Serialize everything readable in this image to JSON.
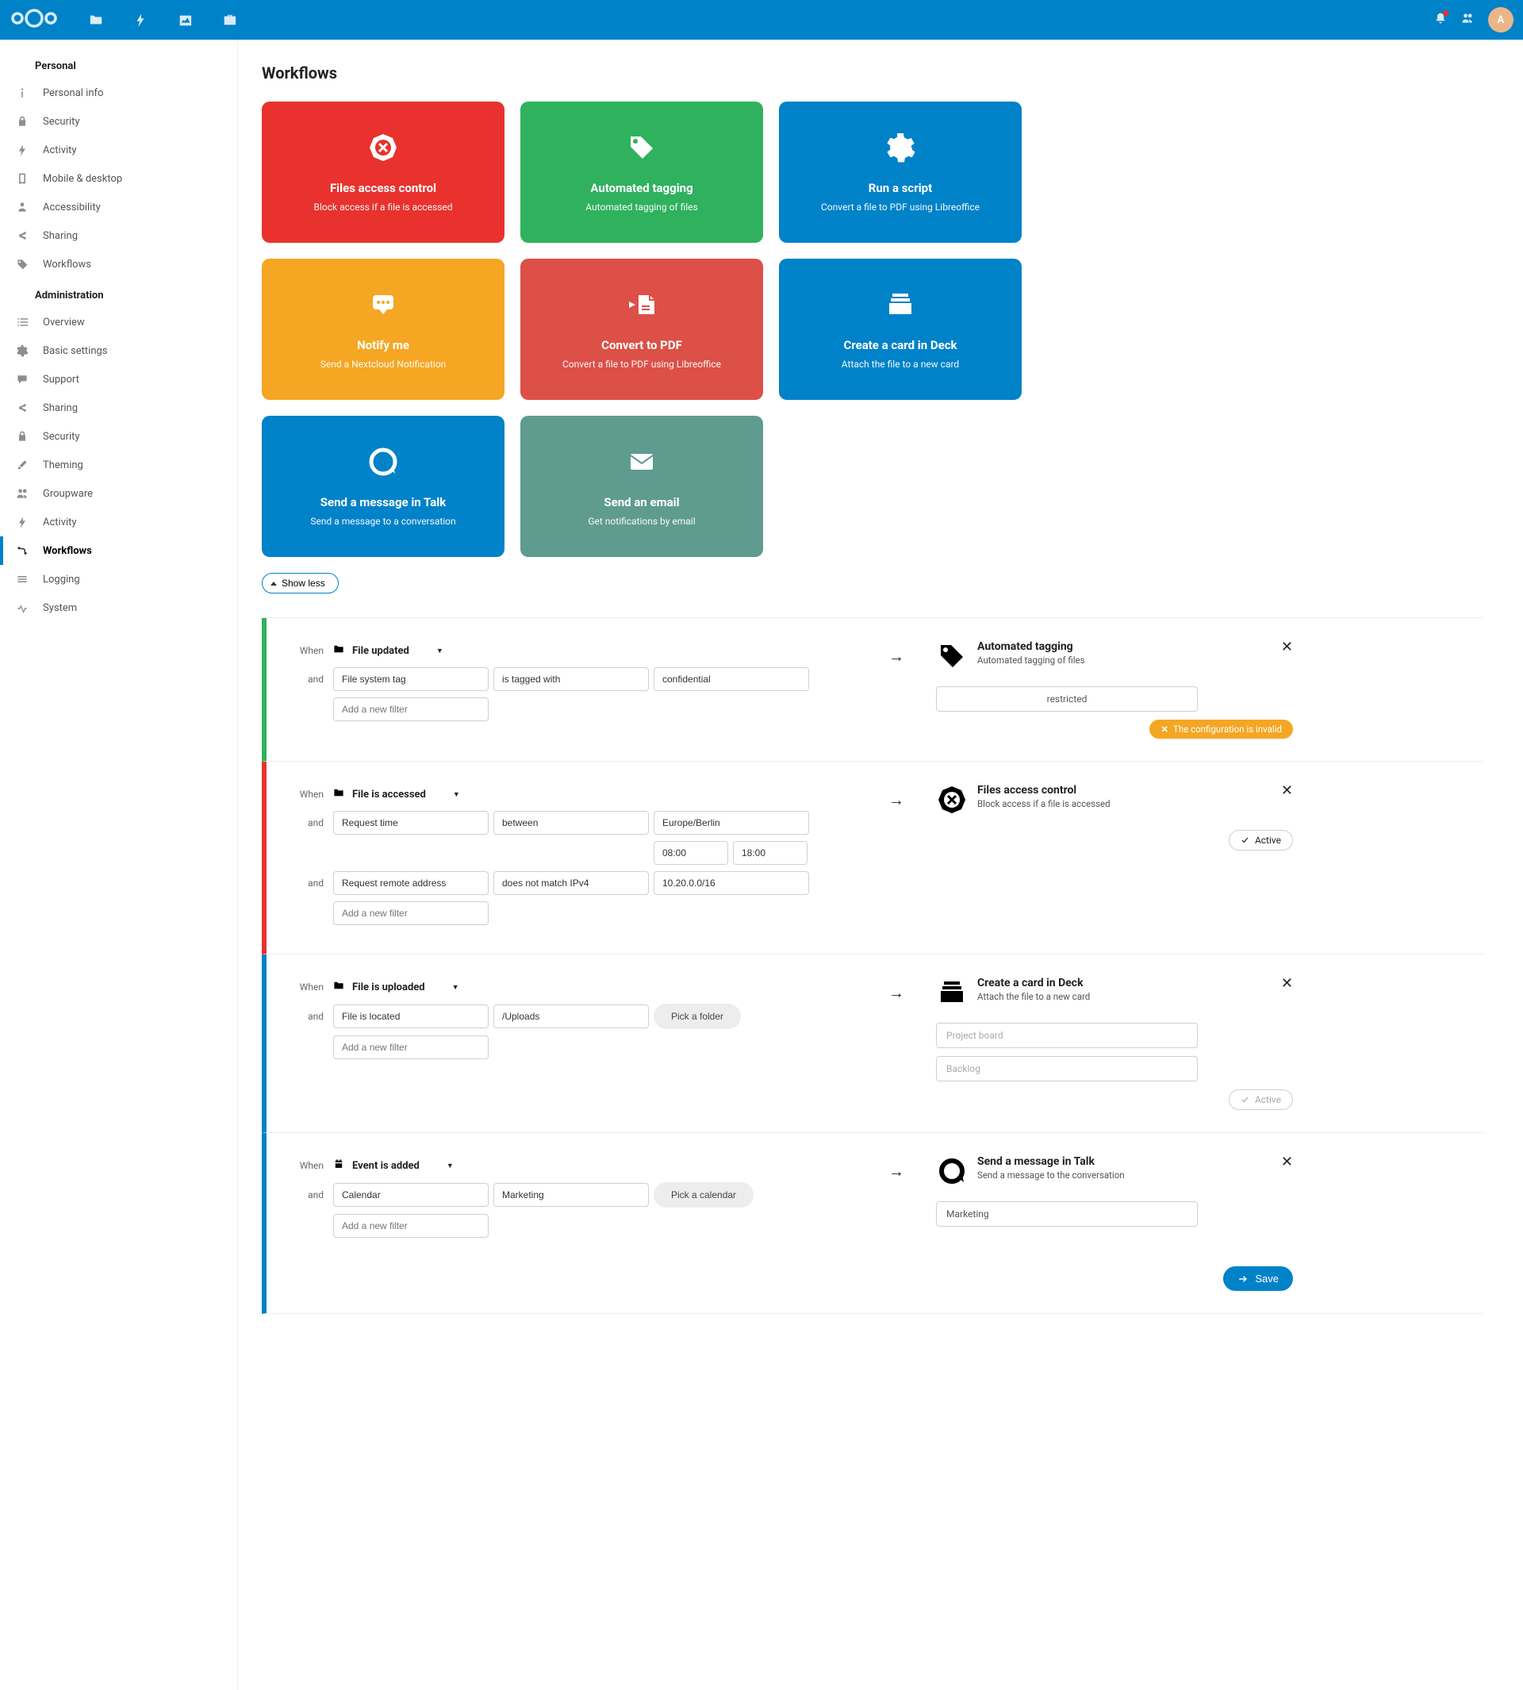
{
  "topbar": {
    "avatar_initial": "A"
  },
  "sidebar": {
    "personal_header": "Personal",
    "personal": [
      {
        "label": "Personal info",
        "key": "personal-info"
      },
      {
        "label": "Security",
        "key": "security"
      },
      {
        "label": "Activity",
        "key": "activity"
      },
      {
        "label": "Mobile & desktop",
        "key": "mobile-desktop"
      },
      {
        "label": "Accessibility",
        "key": "accessibility"
      },
      {
        "label": "Sharing",
        "key": "sharing"
      },
      {
        "label": "Workflows",
        "key": "workflows-personal"
      }
    ],
    "admin_header": "Administration",
    "admin": [
      {
        "label": "Overview",
        "key": "overview"
      },
      {
        "label": "Basic settings",
        "key": "basic-settings"
      },
      {
        "label": "Support",
        "key": "support"
      },
      {
        "label": "Sharing",
        "key": "sharing-admin"
      },
      {
        "label": "Security",
        "key": "security-admin"
      },
      {
        "label": "Theming",
        "key": "theming"
      },
      {
        "label": "Groupware",
        "key": "groupware"
      },
      {
        "label": "Activity",
        "key": "activity-admin"
      },
      {
        "label": "Workflows",
        "key": "workflows-admin"
      },
      {
        "label": "Logging",
        "key": "logging"
      },
      {
        "label": "System",
        "key": "system"
      }
    ]
  },
  "page": {
    "title": "Workflows",
    "show_less": "Show less"
  },
  "cards": [
    {
      "title": "Files access control",
      "desc": "Block access if a file is accessed",
      "color": "#e9322d",
      "icon": "block"
    },
    {
      "title": "Automated tagging",
      "desc": "Automated tagging of files",
      "color": "#2fb15e",
      "icon": "tag"
    },
    {
      "title": "Run a script",
      "desc": "Convert a file to PDF using Libreoffice",
      "color": "#0082c9",
      "icon": "gear"
    },
    {
      "title": "Notify me",
      "desc": "Send a Nextcloud Notification",
      "color": "#f5a623",
      "icon": "chat"
    },
    {
      "title": "Convert to PDF",
      "desc": "Convert a file to PDF using Libreoffice",
      "color": "#dc5047",
      "icon": "pdf"
    },
    {
      "title": "Create a card in Deck",
      "desc": "Attach the file to a new card",
      "color": "#0082c9",
      "icon": "deck"
    },
    {
      "title": "Send a message in Talk",
      "desc": "Send a message to a conversation",
      "color": "#0082c9",
      "icon": "talk"
    },
    {
      "title": "Send an email",
      "desc": "Get notifications by email",
      "color": "#5f9b8f",
      "icon": "mail"
    }
  ],
  "rules": [
    {
      "color": "green",
      "trigger_icon": "folder",
      "trigger": "File updated",
      "conditions": [
        {
          "lbl": "and",
          "a": "File system tag",
          "b": "is tagged with",
          "c": "confidential"
        }
      ],
      "add_filter": "Add a new filter",
      "when": "When",
      "action": {
        "icon": "tag",
        "title": "Automated tagging",
        "desc": "Automated tagging of files"
      },
      "field_center": "restricted",
      "invalid": "The configuration is invalid"
    },
    {
      "color": "red",
      "trigger_icon": "folder",
      "trigger": "File is accessed",
      "conditions": [
        {
          "lbl": "and",
          "a": "Request time",
          "b": "between",
          "c": "Europe/Berlin",
          "c2a": "08:00",
          "c2b": "18:00"
        },
        {
          "lbl": "and",
          "a": "Request remote address",
          "b": "does not match IPv4",
          "c": "10.20.0.0/16"
        }
      ],
      "add_filter": "Add a new filter",
      "when": "When",
      "action": {
        "icon": "block",
        "title": "Files access control",
        "desc": "Block access if a file is accessed"
      },
      "active": "Active"
    },
    {
      "color": "blue",
      "trigger_icon": "folder",
      "trigger": "File is uploaded",
      "conditions": [
        {
          "lbl": "and",
          "a": "File is located",
          "c": "/Uploads",
          "pick": "Pick a folder"
        }
      ],
      "add_filter": "Add a new filter",
      "when": "When",
      "action": {
        "icon": "deck",
        "title": "Create a card in Deck",
        "desc": "Attach the file to a new card"
      },
      "field1_ph": "Project board",
      "field2_ph": "Backlog",
      "inactive": "Active"
    },
    {
      "color": "blue",
      "trigger_icon": "calendar",
      "trigger": "Event is added",
      "conditions": [
        {
          "lbl": "and",
          "a": "Calendar",
          "c": "Marketing",
          "pick": "Pick a calendar"
        }
      ],
      "add_filter": "Add a new filter",
      "when": "When",
      "action": {
        "icon": "talk",
        "title": "Send a message in Talk",
        "desc": "Send a message to the conversation"
      },
      "field1": "Marketing",
      "save": "Save"
    }
  ]
}
